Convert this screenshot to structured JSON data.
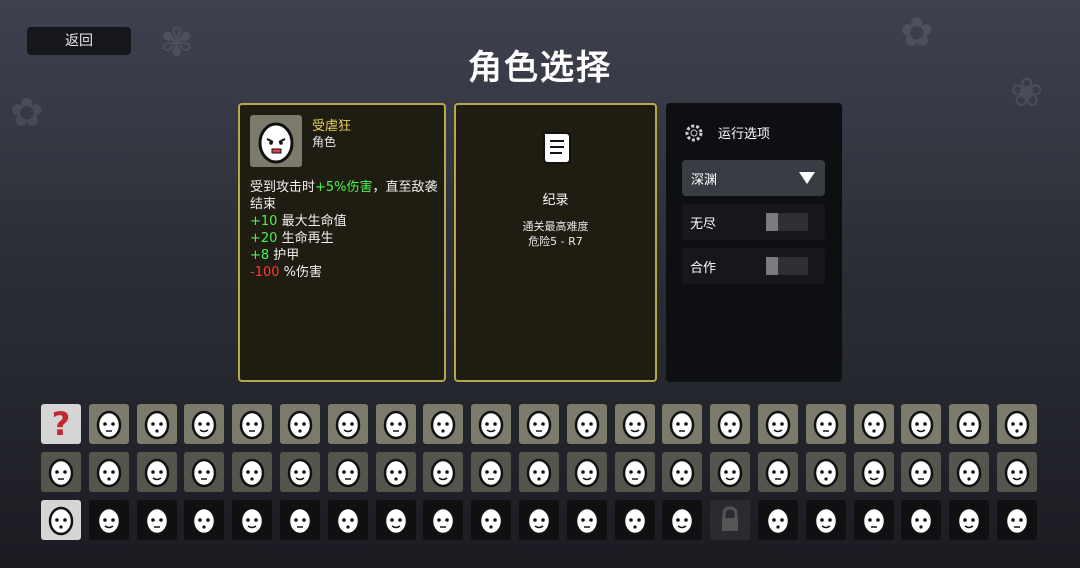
{
  "back_label": "返回",
  "title": "角色选择",
  "character": {
    "name": "受虐狂",
    "type": "角色",
    "description": {
      "line1_pre": "受到攻击时",
      "line1_green": "+5%伤害",
      "line1_post": "，直至敌袭结束",
      "stats": [
        {
          "value": "+10",
          "label": " 最大生命值",
          "color": "green"
        },
        {
          "value": "+20",
          "label": " 生命再生",
          "color": "green"
        },
        {
          "value": "+8",
          "label": " 护甲",
          "color": "green"
        },
        {
          "value": "-100",
          "label": " %伤害",
          "color": "red"
        }
      ]
    }
  },
  "record": {
    "icon": "scroll-icon",
    "title": "纪录",
    "label": "通关最高难度",
    "value": "危险5 - R7"
  },
  "run_options": {
    "icon": "gear-ring-icon",
    "title": "运行选项",
    "difficulty_selected": "深渊",
    "options": [
      {
        "label": "无尽",
        "enabled": false
      },
      {
        "label": "合作",
        "enabled": false
      }
    ]
  },
  "roster": {
    "row1_count": 21,
    "row2_count": 21,
    "row3_count": 21,
    "random_icon": "question-mark-icon",
    "selected_index_row3": 0,
    "locked_index_row3": 14
  },
  "colors": {
    "accent_gold": "#b8a84c",
    "name_yellow": "#e9d35a",
    "positive_green": "#4df24d",
    "negative_red": "#ff3a3a"
  }
}
